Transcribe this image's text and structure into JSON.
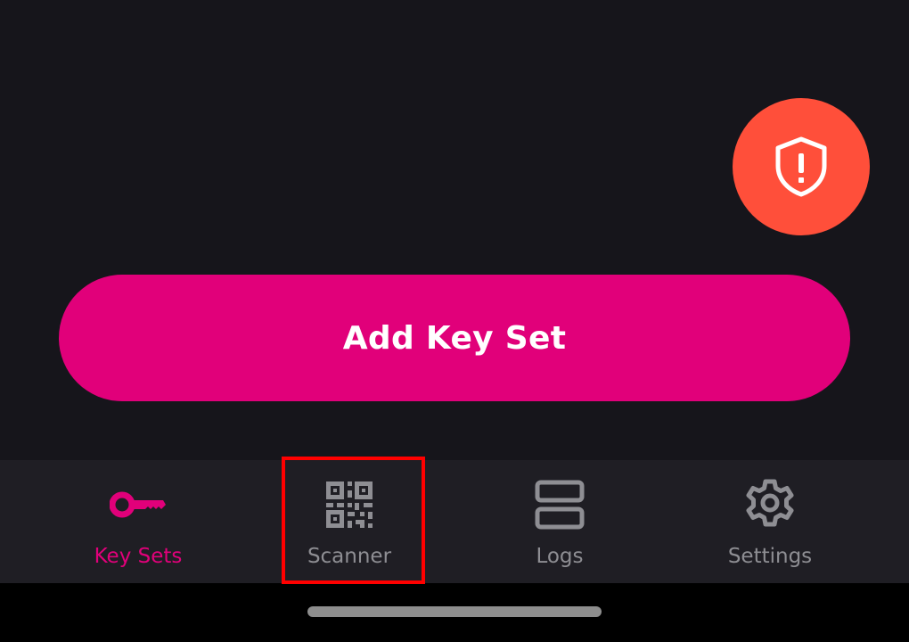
{
  "colors": {
    "background": "#16151b",
    "accent": "#e1007a",
    "alert": "#ff4f3a",
    "tab_bar": "#1f1e24",
    "tab_inactive": "#8e8e93",
    "highlight": "#ff0000"
  },
  "alert_button": {
    "icon": "shield-alert-icon"
  },
  "main": {
    "add_button_label": "Add Key Set"
  },
  "tabs": [
    {
      "label": "Key Sets",
      "icon": "key-icon",
      "active": true
    },
    {
      "label": "Scanner",
      "icon": "qr-code-icon",
      "active": false
    },
    {
      "label": "Logs",
      "icon": "logs-icon",
      "active": false
    },
    {
      "label": "Settings",
      "icon": "gear-icon",
      "active": false
    }
  ]
}
